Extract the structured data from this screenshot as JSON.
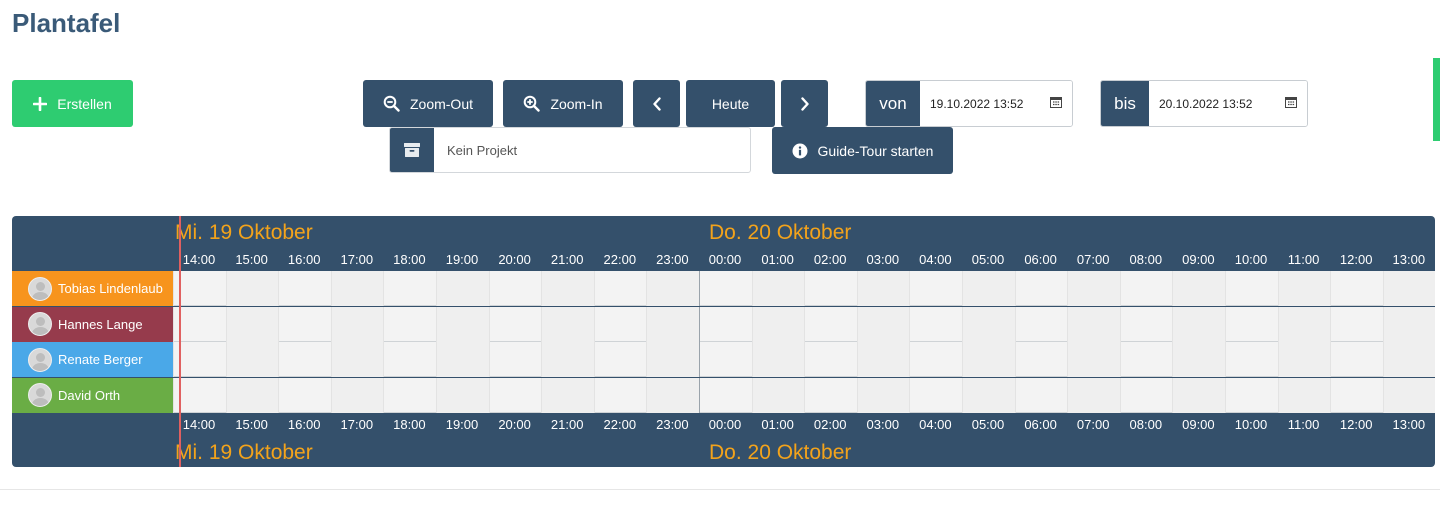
{
  "page": {
    "title": "Plantafel"
  },
  "toolbar": {
    "create_label": "Erstellen",
    "zoom_out_label": "Zoom-Out",
    "zoom_in_label": "Zoom-In",
    "today_label": "Heute",
    "guide_label": "Guide-Tour starten"
  },
  "date_range": {
    "from_label": "von",
    "from_value": "19.10.2022 13:52",
    "to_label": "bis",
    "to_value": "20.10.2022 13:52"
  },
  "project": {
    "placeholder": "Kein Projekt"
  },
  "gantt": {
    "days": [
      "Mi. 19 Oktober",
      "Do. 20 Oktober"
    ],
    "hours": [
      "14:00",
      "15:00",
      "16:00",
      "17:00",
      "18:00",
      "19:00",
      "20:00",
      "21:00",
      "22:00",
      "23:00",
      "00:00",
      "01:00",
      "02:00",
      "03:00",
      "04:00",
      "05:00",
      "06:00",
      "07:00",
      "08:00",
      "09:00",
      "10:00",
      "11:00",
      "12:00",
      "13:00"
    ],
    "resources": [
      {
        "name": "Tobias Lindenlaub",
        "color": "#f7941d"
      },
      {
        "name": "Hannes Lange",
        "color": "#963b4c"
      },
      {
        "name": "Renate Berger",
        "color": "#4aa8e8"
      },
      {
        "name": "David Orth",
        "color": "#6aad45"
      }
    ]
  },
  "colors": {
    "accent": "#34506b",
    "success": "#2ecc71",
    "day_label": "#f3a31b",
    "now_line": "#e06060"
  }
}
